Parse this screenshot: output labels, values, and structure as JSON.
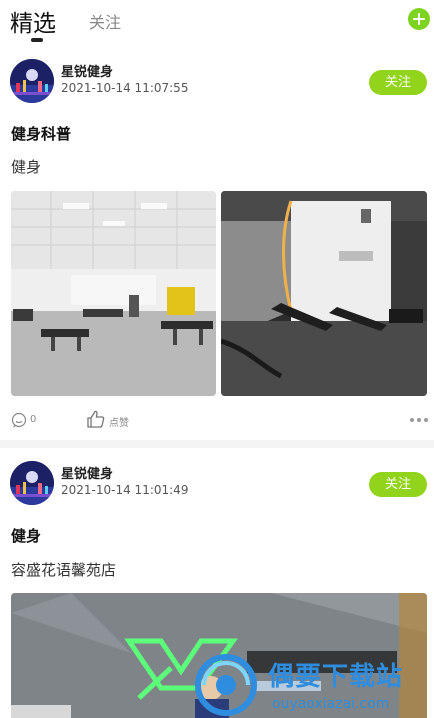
{
  "tabs": {
    "active": "精选",
    "inactive": "关注"
  },
  "posts": [
    {
      "author": "星锐健身",
      "time": "2021-10-14 11:07:55",
      "follow_label": "关注",
      "title": "健身科普",
      "body": "健身",
      "comment_count": "0",
      "like_label": "点赞",
      "images": [
        "gym-equipment-room-photo",
        "gym-bench-room-photo"
      ]
    },
    {
      "author": "星锐健身",
      "time": "2021-10-14 11:01:49",
      "follow_label": "关注",
      "title": "健身",
      "body": "容盛花语馨苑店",
      "images": [
        "gym-reception-photo"
      ]
    }
  ],
  "watermark": {
    "text": "偶要下载站",
    "url": "ouyaoxiazai.com"
  },
  "colors": {
    "accent": "#92d41b",
    "watermark": "#2f8ddf"
  }
}
